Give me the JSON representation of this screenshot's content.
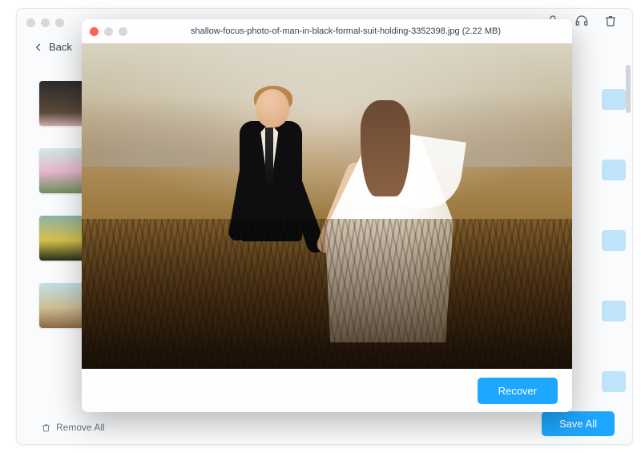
{
  "back": {
    "back_label": "Back",
    "remove_all_label": "Remove All",
    "save_all_label": "Save All"
  },
  "modal": {
    "filename": "shallow-focus-photo-of-man-in-black-formal-suit-holding-3352398.jpg",
    "filesize": "(2.22 MB)",
    "recover_label": "Recover"
  },
  "icons": {
    "user": "user-icon",
    "headset": "headset-icon",
    "trash": "trash-icon"
  },
  "colors": {
    "accent": "#1ea7ff"
  }
}
